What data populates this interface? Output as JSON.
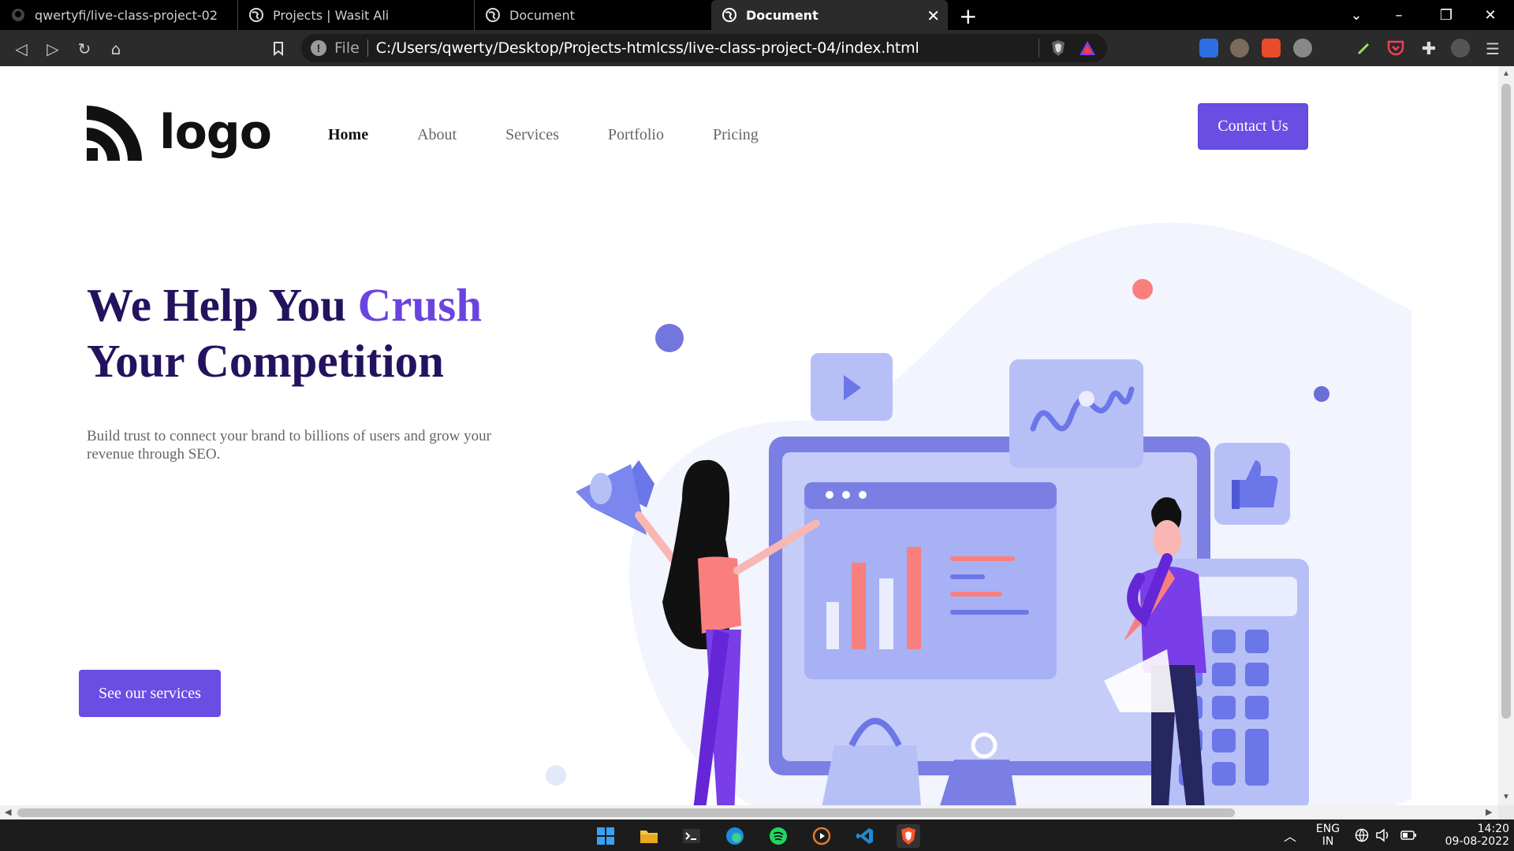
{
  "browser": {
    "tabs": [
      {
        "title": "qwertyfi/live-class-project-02",
        "icon": "github-icon",
        "active": false
      },
      {
        "title": "Projects | Wasit Ali",
        "icon": "globe-icon",
        "active": false
      },
      {
        "title": "Document",
        "icon": "globe-icon",
        "active": false
      },
      {
        "title": "Document",
        "icon": "globe-icon",
        "active": true
      }
    ],
    "new_tab_symbol": "+",
    "address": {
      "scheme_label": "File",
      "url": "C:/Users/qwerty/Desktop/Projects-htmlcss/live-class-project-04/index.html"
    },
    "extensions": [
      "bitwarden-icon",
      "privacy-badger-icon",
      "todoist-icon",
      "wappalyzer-icon",
      "color-picker-icon",
      "pocket-icon",
      "extensions-puzzle-icon",
      "profile-icon"
    ]
  },
  "site": {
    "logo_text": "logo",
    "nav": [
      "Home",
      "About",
      "Services",
      "Portfolio",
      "Pricing"
    ],
    "active_nav": "Home",
    "cta": "Contact Us",
    "hero": {
      "title_part1": "We Help You ",
      "title_accent": "Crush",
      "title_part2": "Your Competition",
      "subtitle": "Build trust to connect your brand to billions of users and grow your revenue through SEO.",
      "button": "See our services"
    },
    "colors": {
      "primary": "#6a4de3",
      "heading": "#23125e",
      "accent": "#6a44e0"
    }
  },
  "taskbar": {
    "apps": [
      "windows-start-icon",
      "file-explorer-icon",
      "terminal-icon",
      "edge-icon",
      "spotify-icon",
      "media-player-icon",
      "vscode-icon",
      "brave-icon"
    ],
    "language": "ENG",
    "region": "IN",
    "time": "14:20",
    "date": "09-08-2022"
  }
}
